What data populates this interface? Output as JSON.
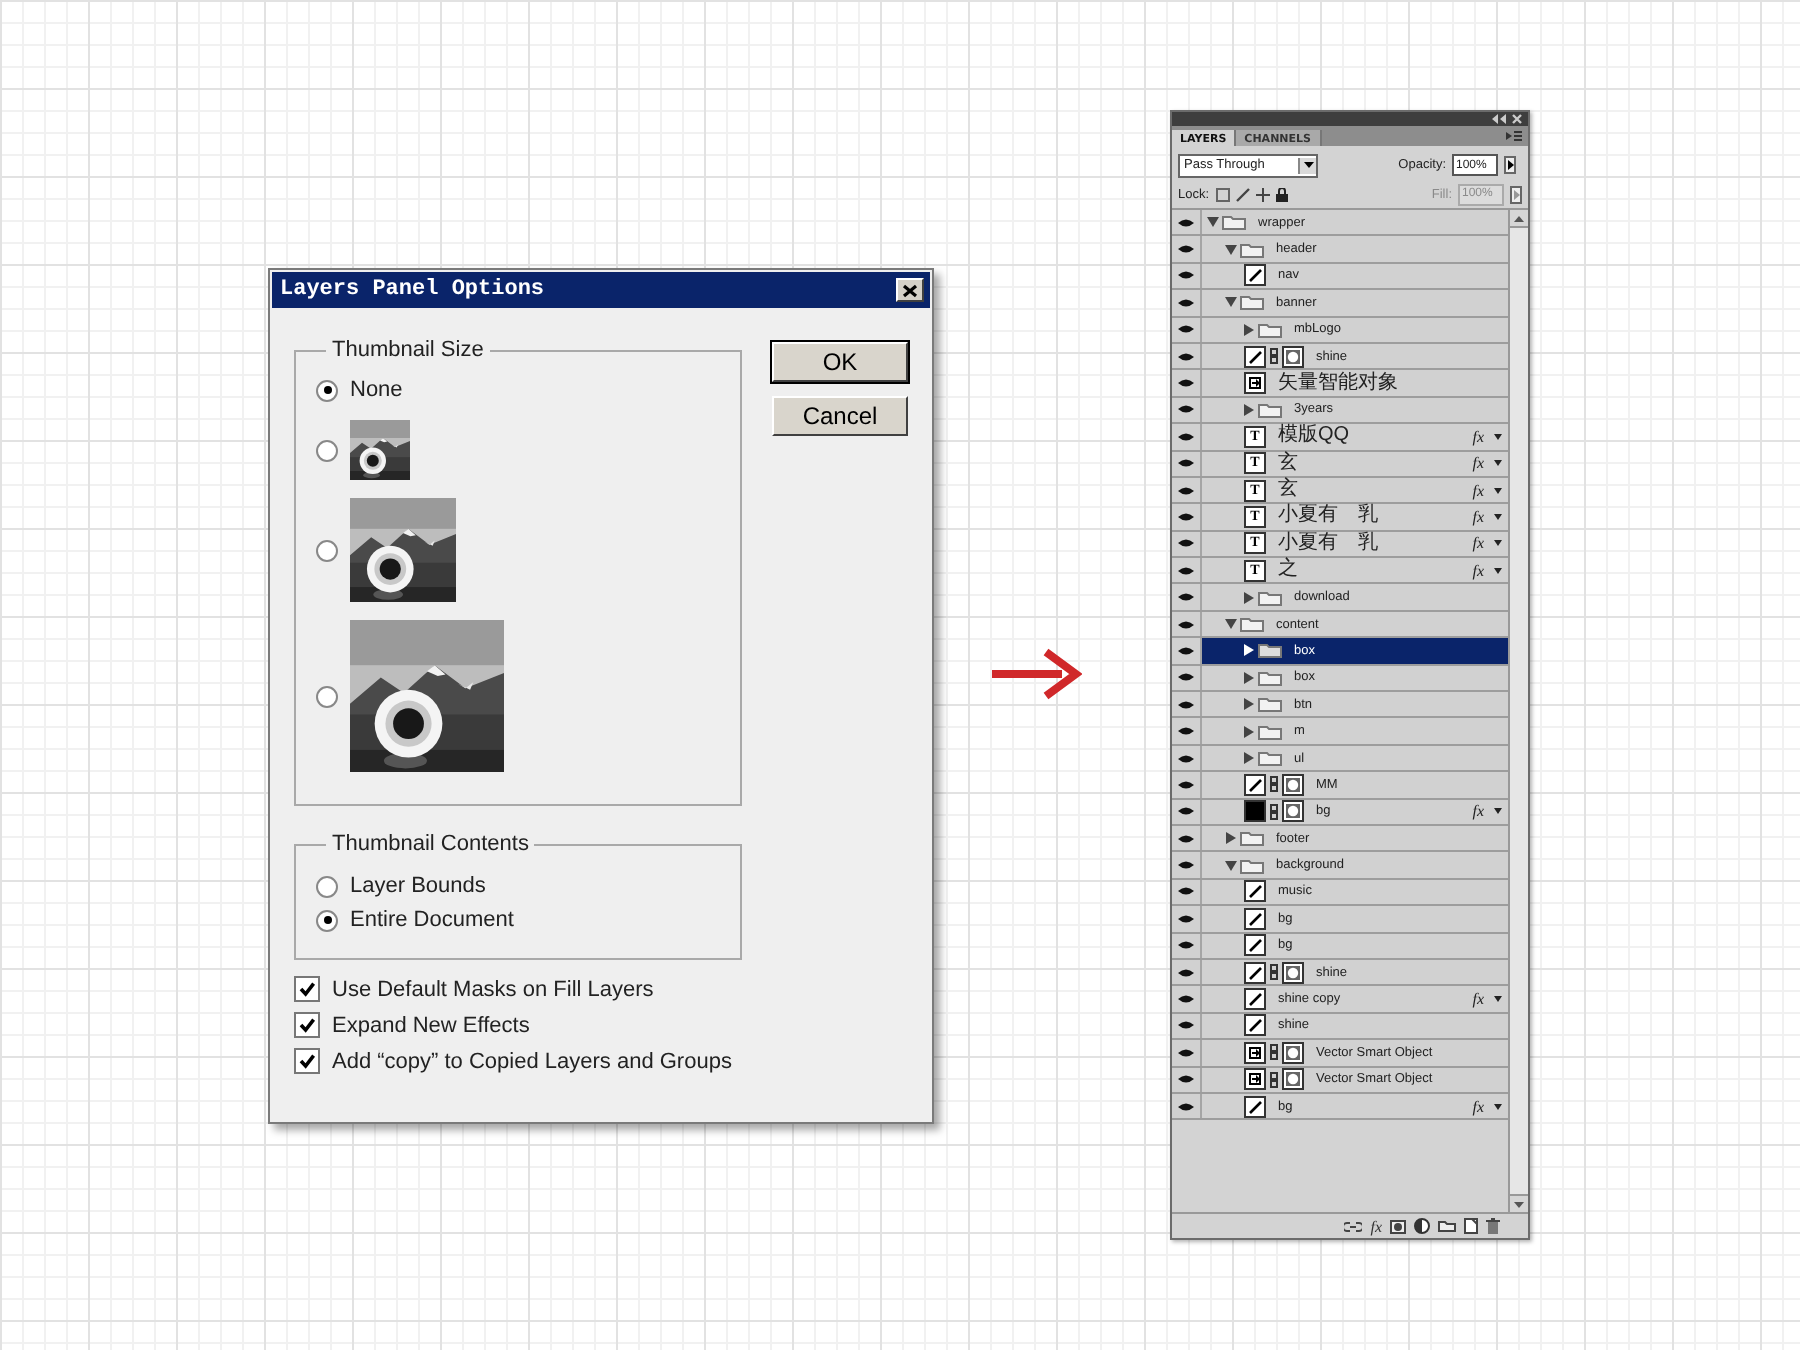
{
  "dialog": {
    "title": "Layers Panel Options",
    "thumbnail_size": {
      "label": "Thumbnail Size",
      "options": [
        {
          "kind": "text",
          "label": "None",
          "selected": true
        },
        {
          "kind": "small",
          "selected": false
        },
        {
          "kind": "medium",
          "selected": false
        },
        {
          "kind": "large",
          "selected": false
        }
      ]
    },
    "thumbnail_contents": {
      "label": "Thumbnail Contents",
      "options": [
        {
          "kind": "text",
          "label": "Layer Bounds",
          "selected": false
        },
        {
          "kind": "text",
          "label": "Entire Document",
          "selected": true
        }
      ]
    },
    "checkboxes": [
      {
        "label": "Use Default Masks on Fill Layers",
        "checked": true
      },
      {
        "label": "Expand New Effects",
        "checked": true
      },
      {
        "label": "Add “copy” to Copied Layers and Groups",
        "checked": true
      }
    ],
    "buttons": [
      "OK",
      "Cancel"
    ]
  },
  "layers_panel": {
    "tabs": [
      {
        "label": "LAYERS",
        "selected": true
      },
      {
        "label": "CHANNELS",
        "selected": false
      }
    ],
    "blend_mode": "Pass Through",
    "opacity_label": "Opacity:",
    "opacity": "100%",
    "lock_label": "Lock:",
    "fill_label": "Fill:",
    "fill": "100%",
    "fill_disabled": true,
    "footer_effects": "fx",
    "layers": [
      {
        "kind": "group",
        "name": "wrapper",
        "expanded": true,
        "selected": false,
        "children": [
          {
            "kind": "group",
            "name": "header",
            "expanded": true,
            "selected": false,
            "children": [
              {
                "kind": "layer",
                "name": "nav",
                "mask": false,
                "selected": false
              }
            ]
          },
          {
            "kind": "group",
            "name": "banner",
            "expanded": true,
            "selected": false,
            "children": [
              {
                "kind": "group",
                "name": "mbLogo",
                "expanded": false,
                "selected": false
              },
              {
                "kind": "layer",
                "name": "shine",
                "mask": true,
                "selected": false
              },
              {
                "kind": "smart",
                "name": "矢量智能对象",
                "mask": false,
                "selected": false
              },
              {
                "kind": "group",
                "name": "3years",
                "expanded": false,
                "selected": false
              },
              {
                "kind": "text",
                "thumb": "T",
                "name": "模版QQ",
                "fx": "fx",
                "selected": false
              },
              {
                "kind": "text",
                "thumb": "T",
                "name": "玄",
                "fx": "fx",
                "selected": false
              },
              {
                "kind": "text",
                "thumb": "T",
                "name": "玄",
                "fx": "fx",
                "selected": false
              },
              {
                "kind": "text",
                "thumb": "T",
                "name": "小夏有　乳",
                "fx": "fx",
                "selected": false
              },
              {
                "kind": "text",
                "thumb": "T",
                "name": "小夏有　乳",
                "fx": "fx",
                "selected": false
              },
              {
                "kind": "text",
                "thumb": "T",
                "name": "之",
                "fx": "fx",
                "selected": false
              },
              {
                "kind": "group",
                "name": "download",
                "expanded": false,
                "selected": false
              }
            ]
          },
          {
            "kind": "group",
            "name": "content",
            "expanded": true,
            "selected": false,
            "children": [
              {
                "kind": "group",
                "name": "box",
                "expanded": false,
                "selected": true
              },
              {
                "kind": "group",
                "name": "box",
                "expanded": false,
                "selected": false
              },
              {
                "kind": "group",
                "name": "btn",
                "expanded": false,
                "selected": false
              },
              {
                "kind": "group",
                "name": "m",
                "expanded": false,
                "selected": false
              },
              {
                "kind": "group",
                "name": "ul",
                "expanded": false,
                "selected": false
              },
              {
                "kind": "layer",
                "name": "MM",
                "mask": true,
                "selected": false
              },
              {
                "kind": "fill",
                "name": "bg",
                "mask": true,
                "fx": "fx",
                "selected": false
              }
            ]
          },
          {
            "kind": "group",
            "name": "footer",
            "expanded": false,
            "selected": false
          },
          {
            "kind": "group",
            "name": "background",
            "expanded": true,
            "selected": false,
            "children": [
              {
                "kind": "layer",
                "name": "music",
                "mask": false,
                "selected": false
              },
              {
                "kind": "layer",
                "name": "bg",
                "mask": false,
                "selected": false
              },
              {
                "kind": "layer",
                "name": "bg",
                "mask": false,
                "selected": false
              },
              {
                "kind": "layer",
                "name": "shine",
                "mask": true,
                "selected": false
              },
              {
                "kind": "layer",
                "name": "shine copy",
                "mask": false,
                "fx": "fx",
                "selected": false
              },
              {
                "kind": "layer",
                "name": "shine",
                "mask": false,
                "selected": false
              },
              {
                "kind": "smart",
                "name": "Vector Smart Object",
                "mask": true,
                "selected": false
              },
              {
                "kind": "smart",
                "name": "Vector Smart Object",
                "mask": true,
                "selected": false
              },
              {
                "kind": "layer",
                "name": "bg",
                "mask": false,
                "fx": "fx",
                "selected": false
              }
            ]
          }
        ]
      }
    ]
  }
}
